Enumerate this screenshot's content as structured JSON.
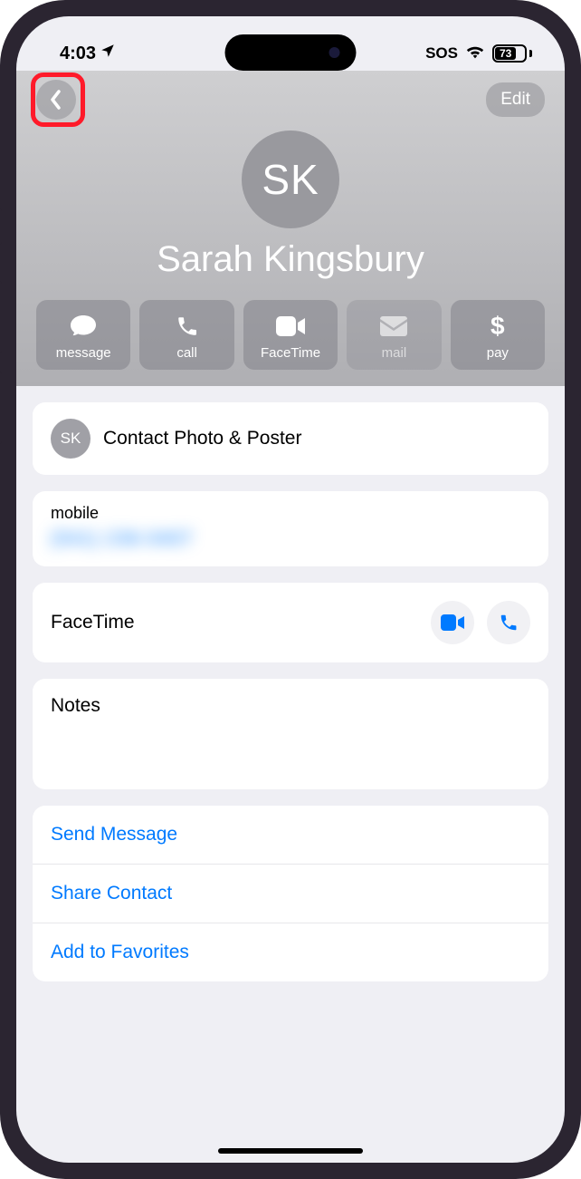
{
  "status": {
    "time": "4:03",
    "sos": "SOS",
    "battery": "73"
  },
  "header": {
    "edit": "Edit",
    "initials": "SK",
    "name": "Sarah Kingsbury"
  },
  "actions": {
    "message": "message",
    "call": "call",
    "facetime": "FaceTime",
    "mail": "mail",
    "pay": "pay"
  },
  "photo_poster": {
    "initials": "SK",
    "label": "Contact Photo & Poster"
  },
  "phone": {
    "label": "mobile",
    "number": "(541) 236-0407"
  },
  "facetime": {
    "label": "FaceTime"
  },
  "notes": {
    "label": "Notes"
  },
  "links": {
    "send_message": "Send Message",
    "share_contact": "Share Contact",
    "add_favorites": "Add to Favorites"
  }
}
